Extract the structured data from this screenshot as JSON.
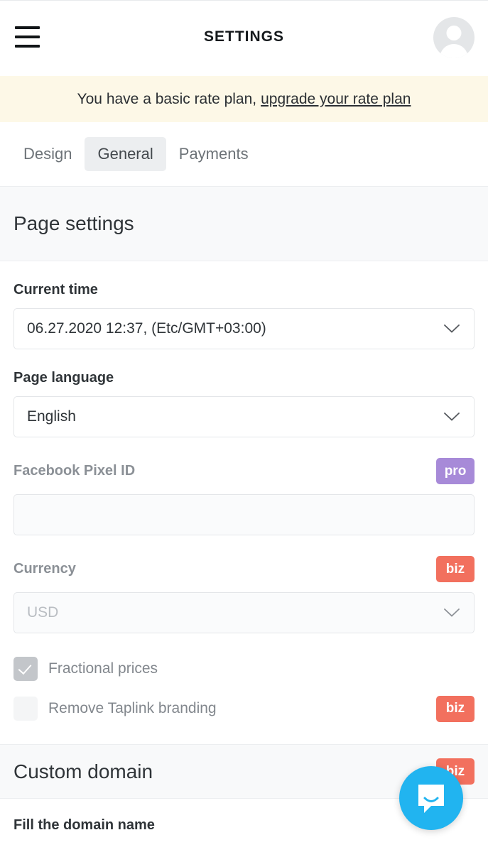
{
  "topbar": {
    "title": "SETTINGS",
    "menu_icon": "hamburger-menu-icon",
    "avatar_icon": "user-avatar-icon"
  },
  "banner": {
    "text": "You have a basic rate plan,",
    "link_text": "upgrade your rate plan",
    "background": "#fdf8e7"
  },
  "tabs": [
    {
      "label": "Design",
      "active": false
    },
    {
      "label": "General",
      "active": true
    },
    {
      "label": "Payments",
      "active": false
    }
  ],
  "page_settings": {
    "heading": "Page settings",
    "current_time": {
      "label": "Current time",
      "value": "06.27.2020 12:37, (Etc/GMT+03:00)"
    },
    "page_language": {
      "label": "Page language",
      "value": "English"
    },
    "facebook_pixel": {
      "label": "Facebook Pixel ID",
      "value": "",
      "badge": "pro",
      "badge_color": "#a78ad8"
    },
    "currency": {
      "label": "Currency",
      "placeholder": "USD",
      "badge": "biz",
      "badge_color": "#f2705e"
    },
    "fractional_prices": {
      "label": "Fractional prices",
      "checked": true
    },
    "remove_branding": {
      "label": "Remove Taplink branding",
      "checked": false,
      "badge": "biz",
      "badge_color": "#f2705e"
    }
  },
  "custom_domain": {
    "heading": "Custom domain",
    "badge": "biz",
    "badge_color": "#f2705e",
    "sub_label": "Fill the domain name"
  },
  "chat_widget": {
    "icon": "intercom-chat-icon",
    "color": "#21b4f0"
  }
}
